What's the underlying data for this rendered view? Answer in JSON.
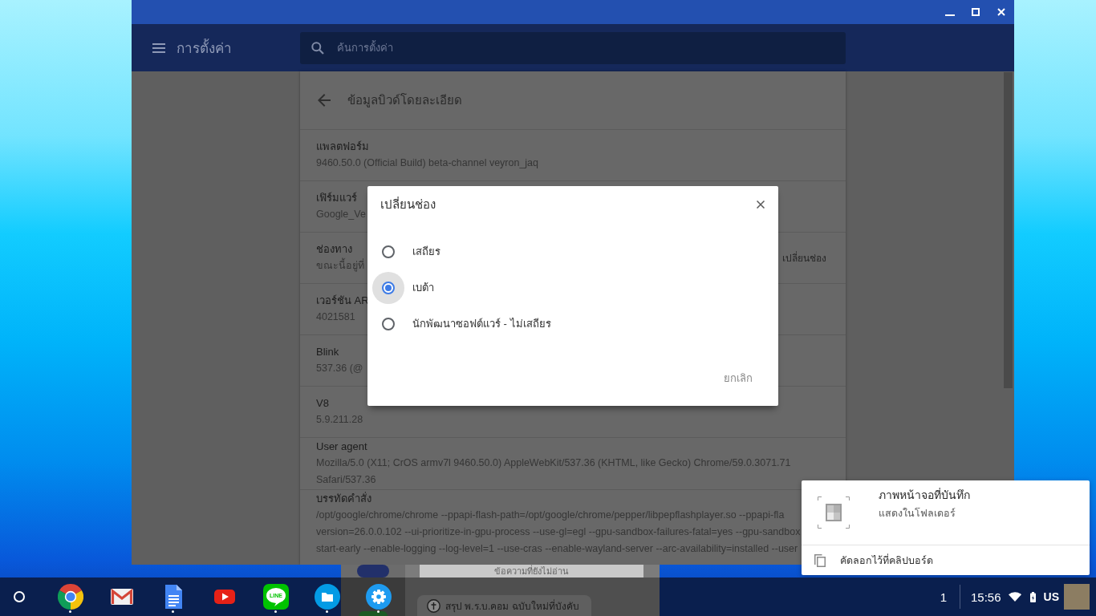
{
  "header": {
    "title": "การตั้งค่า",
    "search": {
      "placeholder": "ค้นการตั้งค่า"
    }
  },
  "page": {
    "title": "ข้อมูลบิวด์โดยละเอียด",
    "rows": [
      {
        "label": "แพลตฟอร์ม",
        "value_lines": [
          "9460.50.0 (Official Build) beta-channel veyron_jaq"
        ]
      },
      {
        "label": "เฟิร์มแวร์",
        "value_lines": [
          "Google_Ve"
        ]
      },
      {
        "label": "ช่องทาง",
        "value_lines": [
          "ขณะนี้อยู่ที่"
        ],
        "button": "เปลี่ยนช่อง"
      },
      {
        "label": "เวอร์ชัน AR",
        "value_lines": [
          "4021581"
        ]
      },
      {
        "label": "Blink",
        "value_lines": [
          "537.36 (@"
        ]
      },
      {
        "label": "V8",
        "value_lines": [
          "5.9.211.28"
        ]
      },
      {
        "label": "User agent",
        "value_lines": [
          "Mozilla/5.0 (X11; CrOS armv7l 9460.50.0) AppleWebKit/537.36 (KHTML, like Gecko) Chrome/59.0.3071.71",
          "Safari/537.36"
        ]
      },
      {
        "label": "บรรทัดคำสั่ง",
        "value_lines": [
          "/opt/google/chrome/chrome --ppapi-flash-path=/opt/google/chrome/pepper/libpepflashplayer.so --ppapi-fla",
          "version=26.0.0.102 --ui-prioritize-in-gpu-process --use-gl=egl --gpu-sandbox-failures-fatal=yes --gpu-sandbox",
          "start-early --enable-logging --log-level=1 --use-cras --enable-wayland-server --arc-availability=installed --user"
        ]
      }
    ]
  },
  "dialog": {
    "title": "เปลี่ยนช่อง",
    "options": [
      {
        "label": "เสถียร",
        "selected": false,
        "focused": false
      },
      {
        "label": "เบต้า",
        "selected": true,
        "focused": true
      },
      {
        "label": "นักพัฒนาซอฟต์แวร์ - ไม่เสถียร",
        "selected": false,
        "focused": false
      }
    ],
    "cancel": "ยกเลิก"
  },
  "notification": {
    "title": "ภาพหน้าจอที่บันทึก",
    "message": "แสดงในโฟลเดอร์",
    "action": "คัดลอกไว้ที่คลิปบอร์ด"
  },
  "background_window": {
    "banner": "ข้อความที่ยังไม่อ่าน",
    "message": "สรุป พ.ร.บ.คอม ฉบับใหม่ที่บังคับ"
  },
  "shelf": {
    "apps": [
      {
        "kind": "browser",
        "running": true
      },
      {
        "kind": "mail",
        "running": false
      },
      {
        "kind": "docs",
        "running": true
      },
      {
        "kind": "video",
        "running": false
      },
      {
        "kind": "chat",
        "label": "LINE",
        "running": true
      },
      {
        "kind": "files",
        "running": true
      },
      {
        "kind": "settings",
        "running": true
      }
    ],
    "notification_count": "1",
    "time": "15:56",
    "keyboard": "US"
  }
}
